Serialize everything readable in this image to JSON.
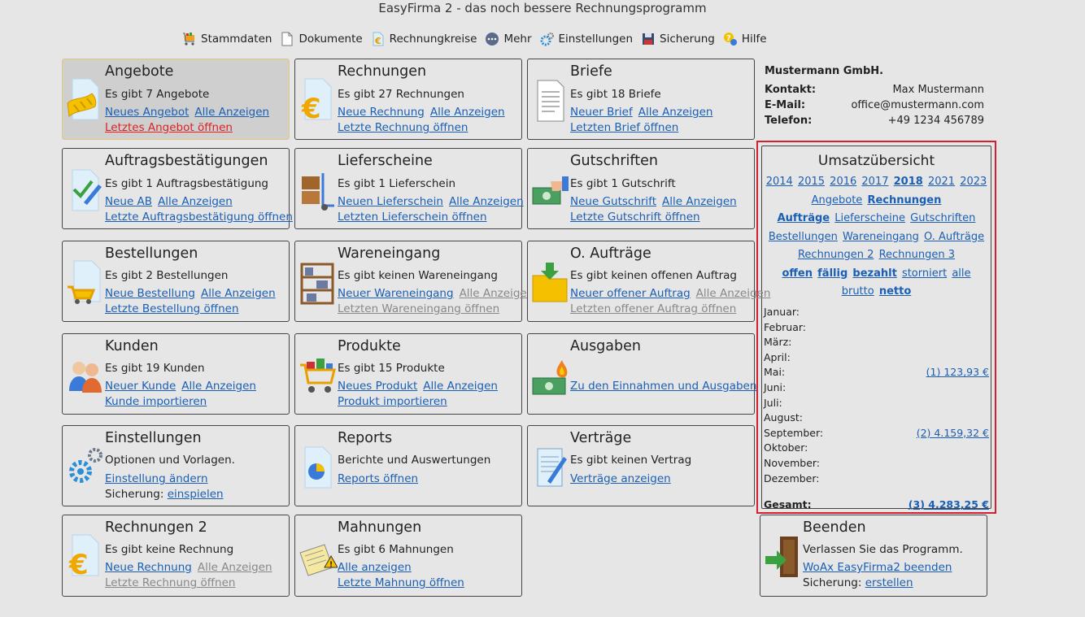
{
  "window": {
    "title": "EasyFirma 2 - das noch bessere Rechnungsprogramm"
  },
  "menu": [
    {
      "label": "Stammdaten",
      "icon": "cart-icon"
    },
    {
      "label": "Dokumente",
      "icon": "document-icon"
    },
    {
      "label": "Rechnungkreise",
      "icon": "euro-icon"
    },
    {
      "label": "Mehr",
      "icon": "more-icon"
    },
    {
      "label": "Einstellungen",
      "icon": "gears-icon"
    },
    {
      "label": "Sicherung",
      "icon": "save-icon"
    },
    {
      "label": "Hilfe",
      "icon": "help-icon"
    }
  ],
  "cards": {
    "angebote": {
      "title": "Angebote",
      "info": "Es gibt 7 Angebote",
      "new": "Neues Angebot",
      "all": "Alle Anzeigen",
      "last": "Letztes Angebot öffnen"
    },
    "rechnungen": {
      "title": "Rechnungen",
      "info": "Es gibt 27 Rechnungen",
      "new": "Neue Rechnung",
      "all": "Alle Anzeigen",
      "last": "Letzte Rechnung öffnen"
    },
    "briefe": {
      "title": "Briefe",
      "info": "Es gibt 18 Briefe",
      "new": "Neuer Brief",
      "all": "Alle Anzeigen",
      "last": "Letzten Brief öffnen"
    },
    "auftrag": {
      "title": "Auftragsbestätigungen",
      "info": "Es gibt 1 Auftragsbestätigung",
      "new": "Neue AB",
      "all": "Alle Anzeigen",
      "last": "Letzte Auftragsbestätigung öffnen"
    },
    "liefer": {
      "title": "Lieferscheine",
      "info": "Es gibt 1 Lieferschein",
      "new": "Neuen Lieferschein",
      "all": "Alle Anzeigen",
      "last": "Letzten Lieferschein öffnen"
    },
    "gutschriften": {
      "title": "Gutschriften",
      "info": "Es gibt 1 Gutschrift",
      "new": "Neue Gutschrift",
      "all": "Alle Anzeigen",
      "last": "Letzte Gutschrift öffnen"
    },
    "bestellungen": {
      "title": "Bestellungen",
      "info": "Es gibt 2 Bestellungen",
      "new": "Neue Bestellung",
      "all": "Alle Anzeigen",
      "last": "Letzte Bestellung öffnen"
    },
    "wareneingang": {
      "title": "Wareneingang",
      "info": "Es gibt keinen Wareneingang",
      "new": "Neuer Wareneingang",
      "all": "Alle Anzeigen",
      "last": "Letzten Wareneingang öffnen"
    },
    "oauftraege": {
      "title": "O. Aufträge",
      "info": "Es gibt keinen offenen Auftrag",
      "new": "Neuer offener Auftrag",
      "all": "Alle Anzeigen",
      "last": "Letzten offener Auftrag öffnen"
    },
    "kunden": {
      "title": "Kunden",
      "info": "Es gibt 19 Kunden",
      "new": "Neuer Kunde",
      "all": "Alle Anzeigen",
      "last": "Kunde importieren"
    },
    "produkte": {
      "title": "Produkte",
      "info": "Es gibt 15 Produkte",
      "new": "Neues Produkt",
      "all": "Alle Anzeigen",
      "last": "Produkt importieren"
    },
    "ausgaben": {
      "title": "Ausgaben",
      "link": "Zu den Einnahmen und Ausgaben"
    },
    "einstellungen": {
      "title": "Einstellungen",
      "info": "Optionen und Vorlagen.",
      "link": "Einstellung ändern",
      "sicherung_label": "Sicherung:",
      "sicherung_link": "einspielen"
    },
    "reports": {
      "title": "Reports",
      "info": "Berichte und Auswertungen",
      "link": "Reports öffnen"
    },
    "vertraege": {
      "title": "Verträge",
      "info": "Es gibt keinen Vertrag",
      "link": "Verträge anzeigen"
    },
    "rechnungen2": {
      "title": "Rechnungen 2",
      "info": "Es gibt keine Rechnung",
      "new": "Neue Rechnung",
      "all": "Alle Anzeigen",
      "last": "Letzte Rechnung öffnen"
    },
    "mahnungen": {
      "title": "Mahnungen",
      "info": "Es gibt 6 Mahnungen",
      "all": "Alle anzeigen",
      "last": "Letzte Mahnung öffnen"
    },
    "beenden": {
      "title": "Beenden",
      "info": "Verlassen Sie das Programm.",
      "link": "WoAx EasyFirma2 beenden",
      "sicherung_label": "Sicherung:",
      "sicherung_link": "erstellen"
    }
  },
  "company": {
    "name": "Mustermann GmbH.",
    "kontakt_label": "Kontakt:",
    "kontakt": "Max Mustermann",
    "email_label": "E-Mail:",
    "email": "office@mustermann.com",
    "telefon_label": "Telefon:",
    "telefon": "+49 1234 456789"
  },
  "umsatz": {
    "title": "Umsatzübersicht",
    "years": [
      "2014",
      "2015",
      "2016",
      "2017",
      "2018",
      "2021",
      "2023"
    ],
    "selected_year": "2018",
    "types_row1": [
      "Angebote",
      "Rechnungen"
    ],
    "types_row2": [
      "Aufträge",
      "Lieferscheine",
      "Gutschriften"
    ],
    "types_row3": [
      "Bestellungen",
      "Wareneingang",
      "O. Aufträge"
    ],
    "types_row4": [
      "Rechnungen 2",
      "Rechnungen 3"
    ],
    "status": [
      "offen",
      "fällig",
      "bezahlt",
      "storniert",
      "alle"
    ],
    "mode": [
      "brutto",
      "netto"
    ],
    "months": [
      {
        "name": "Januar:",
        "value": ""
      },
      {
        "name": "Februar:",
        "value": ""
      },
      {
        "name": "März:",
        "value": ""
      },
      {
        "name": "April:",
        "value": ""
      },
      {
        "name": "Mai:",
        "value": "(1)  123,93 €"
      },
      {
        "name": "Juni:",
        "value": ""
      },
      {
        "name": "Juli:",
        "value": ""
      },
      {
        "name": "August:",
        "value": ""
      },
      {
        "name": "September:",
        "value": "(2)  4.159,32 €"
      },
      {
        "name": "Oktober:",
        "value": ""
      },
      {
        "name": "November:",
        "value": ""
      },
      {
        "name": "Dezember:",
        "value": ""
      }
    ],
    "total_label": "Gesamt:",
    "total_value": "(3) 4.283,25 €"
  },
  "colors": {
    "link": "#1a5fb4",
    "highlight_border": "#d42030",
    "selected_card": "#cfcfcf"
  }
}
